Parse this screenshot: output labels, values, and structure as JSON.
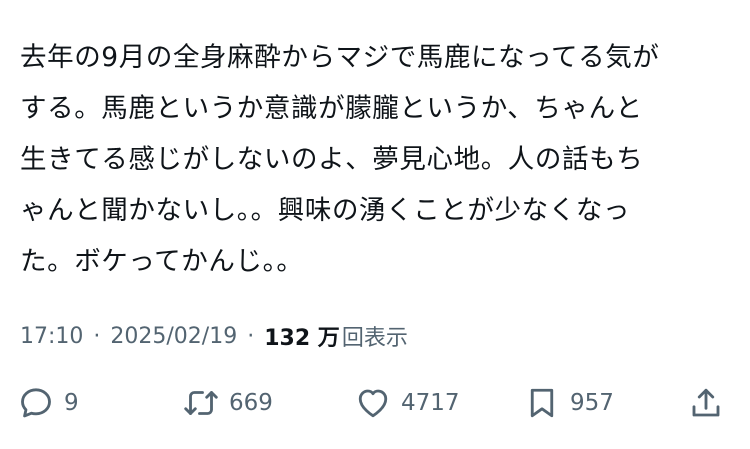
{
  "tweet": {
    "lines": [
      "去年の9月の全身麻酔からマジで馬鹿になってる気が",
      "する。馬鹿というか意識が朦朧というか、ちゃんと",
      "生きてる感じがしないのよ、夢見心地。人の話もち",
      "ゃんと聞かないし。。興味の湧くことが少なくなっ",
      "た。ボケってかんじ。。"
    ]
  },
  "meta": {
    "time": "17:10",
    "separator": "·",
    "date": "2025/02/19",
    "views_count": "132 万",
    "views_label": "回表示"
  },
  "actions": {
    "replies": "9",
    "reposts": "669",
    "likes": "4717",
    "bookmarks": "957"
  },
  "icons": {
    "reply": "reply-icon",
    "repost": "repost-icon",
    "like": "heart-icon",
    "bookmark": "bookmark-icon",
    "share": "share-icon"
  },
  "colors": {
    "text": "#0f1419",
    "muted": "#536471",
    "background": "#ffffff"
  }
}
